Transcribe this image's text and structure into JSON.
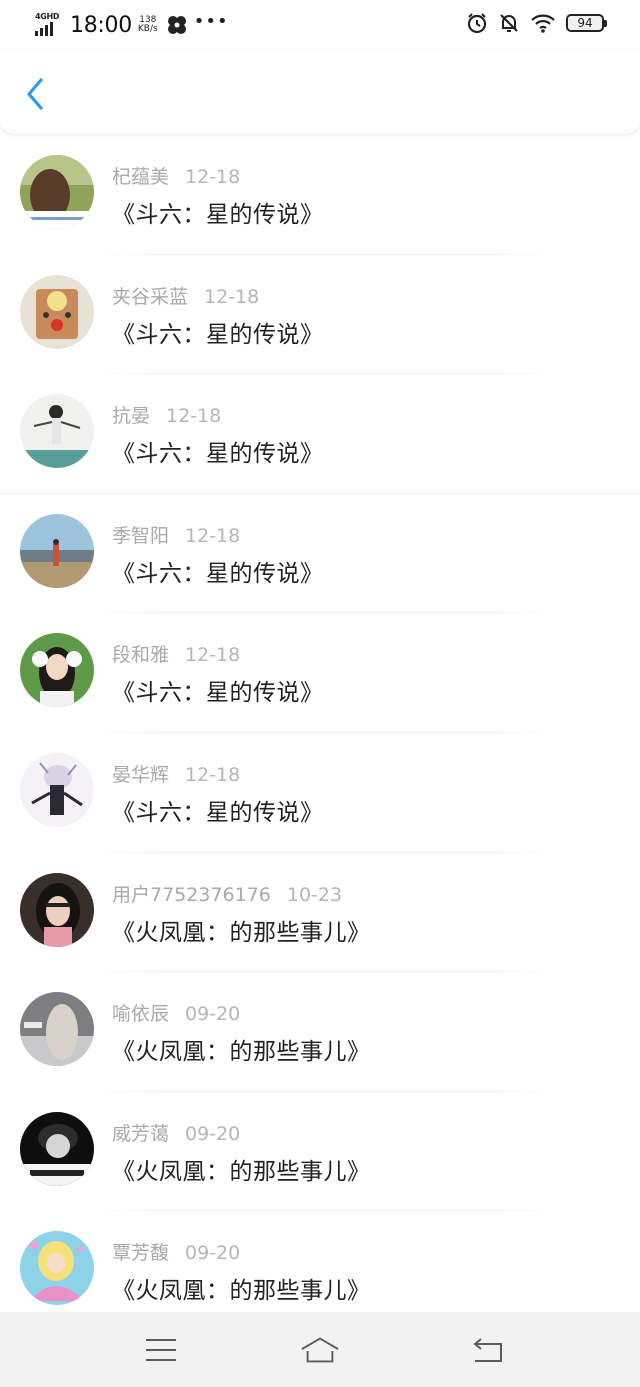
{
  "status_bar": {
    "network": "4GHD",
    "time": "18:00",
    "speed_value": "138",
    "speed_unit": "KB/s",
    "battery": "94",
    "icons": [
      "signal-icon",
      "fan-icon",
      "more-dots-icon",
      "alarm-icon",
      "bell-muted-icon",
      "wifi-icon",
      "battery-icon"
    ]
  },
  "header": {
    "back_icon": "chevron-left-icon",
    "accent_color": "#2b9af3"
  },
  "list": [
    {
      "name": "杞蕴美",
      "date": "12-18",
      "title": "《斗六：星的传说》",
      "avatar": "avatar-photo-1"
    },
    {
      "name": "夹谷采蓝",
      "date": "12-18",
      "title": "《斗六：星的传说》",
      "avatar": "avatar-photo-2"
    },
    {
      "name": "抗晏",
      "date": "12-18",
      "title": "《斗六：星的传说》",
      "avatar": "avatar-photo-3"
    },
    {
      "name": "季智阳",
      "date": "12-18",
      "title": "《斗六：星的传说》",
      "avatar": "avatar-photo-4"
    },
    {
      "name": "段和雅",
      "date": "12-18",
      "title": "《斗六：星的传说》",
      "avatar": "avatar-photo-5"
    },
    {
      "name": "晏华辉",
      "date": "12-18",
      "title": "《斗六：星的传说》",
      "avatar": "avatar-photo-6"
    },
    {
      "name": "用户7752376176",
      "date": "10-23",
      "title": "《火凤凰：的那些事儿》",
      "avatar": "avatar-photo-7"
    },
    {
      "name": "喻依辰",
      "date": "09-20",
      "title": "《火凤凰：的那些事儿》",
      "avatar": "avatar-photo-8"
    },
    {
      "name": "威芳蔼",
      "date": "09-20",
      "title": "《火凤凰：的那些事儿》",
      "avatar": "avatar-photo-9"
    },
    {
      "name": "覃芳馥",
      "date": "09-20",
      "title": "《火凤凰：的那些事儿》",
      "avatar": "avatar-photo-10"
    }
  ],
  "bottom_nav": {
    "icons": [
      "menu-icon",
      "home-icon",
      "back-return-icon"
    ]
  }
}
